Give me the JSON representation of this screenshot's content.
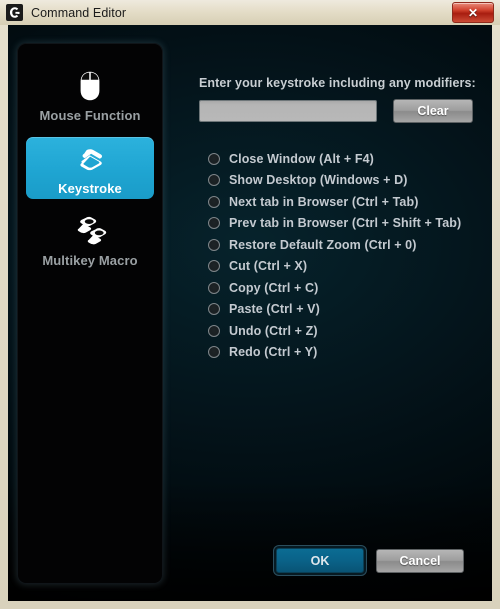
{
  "window": {
    "title": "Command Editor",
    "logo_icon": "logitech-g-logo-icon",
    "close_label": "✕"
  },
  "sidebar": {
    "items": [
      {
        "id": "mouse-function",
        "label": "Mouse Function",
        "icon": "mouse-icon",
        "selected": false
      },
      {
        "id": "keystroke",
        "label": "Keystroke",
        "icon": "keycap-icon",
        "selected": true
      },
      {
        "id": "multikey-macro",
        "label": "Multikey Macro",
        "icon": "double-keycap-icon",
        "selected": false
      }
    ]
  },
  "main": {
    "prompt": "Enter your keystroke including any modifiers:",
    "keystroke_input": {
      "value": "",
      "placeholder": ""
    },
    "clear_label": "Clear",
    "options": [
      "Close Window (Alt + F4)",
      "Show Desktop (Windows + D)",
      "Next tab in Browser (Ctrl + Tab)",
      "Prev tab in Browser (Ctrl + Shift + Tab)",
      "Restore Default Zoom (Ctrl + 0)",
      "Cut (Ctrl + X)",
      "Copy (Ctrl + C)",
      "Paste (Ctrl + V)",
      "Undo (Ctrl + Z)",
      "Redo (Ctrl + Y)"
    ],
    "selected_option": null
  },
  "footer": {
    "ok_label": "OK",
    "cancel_label": "Cancel"
  },
  "colors": {
    "accent": "#1fa5d2",
    "ok_button": "#0a6288",
    "close_button": "#c0392b",
    "frame": "#e0d9c4",
    "text_light": "#c4cad0"
  }
}
